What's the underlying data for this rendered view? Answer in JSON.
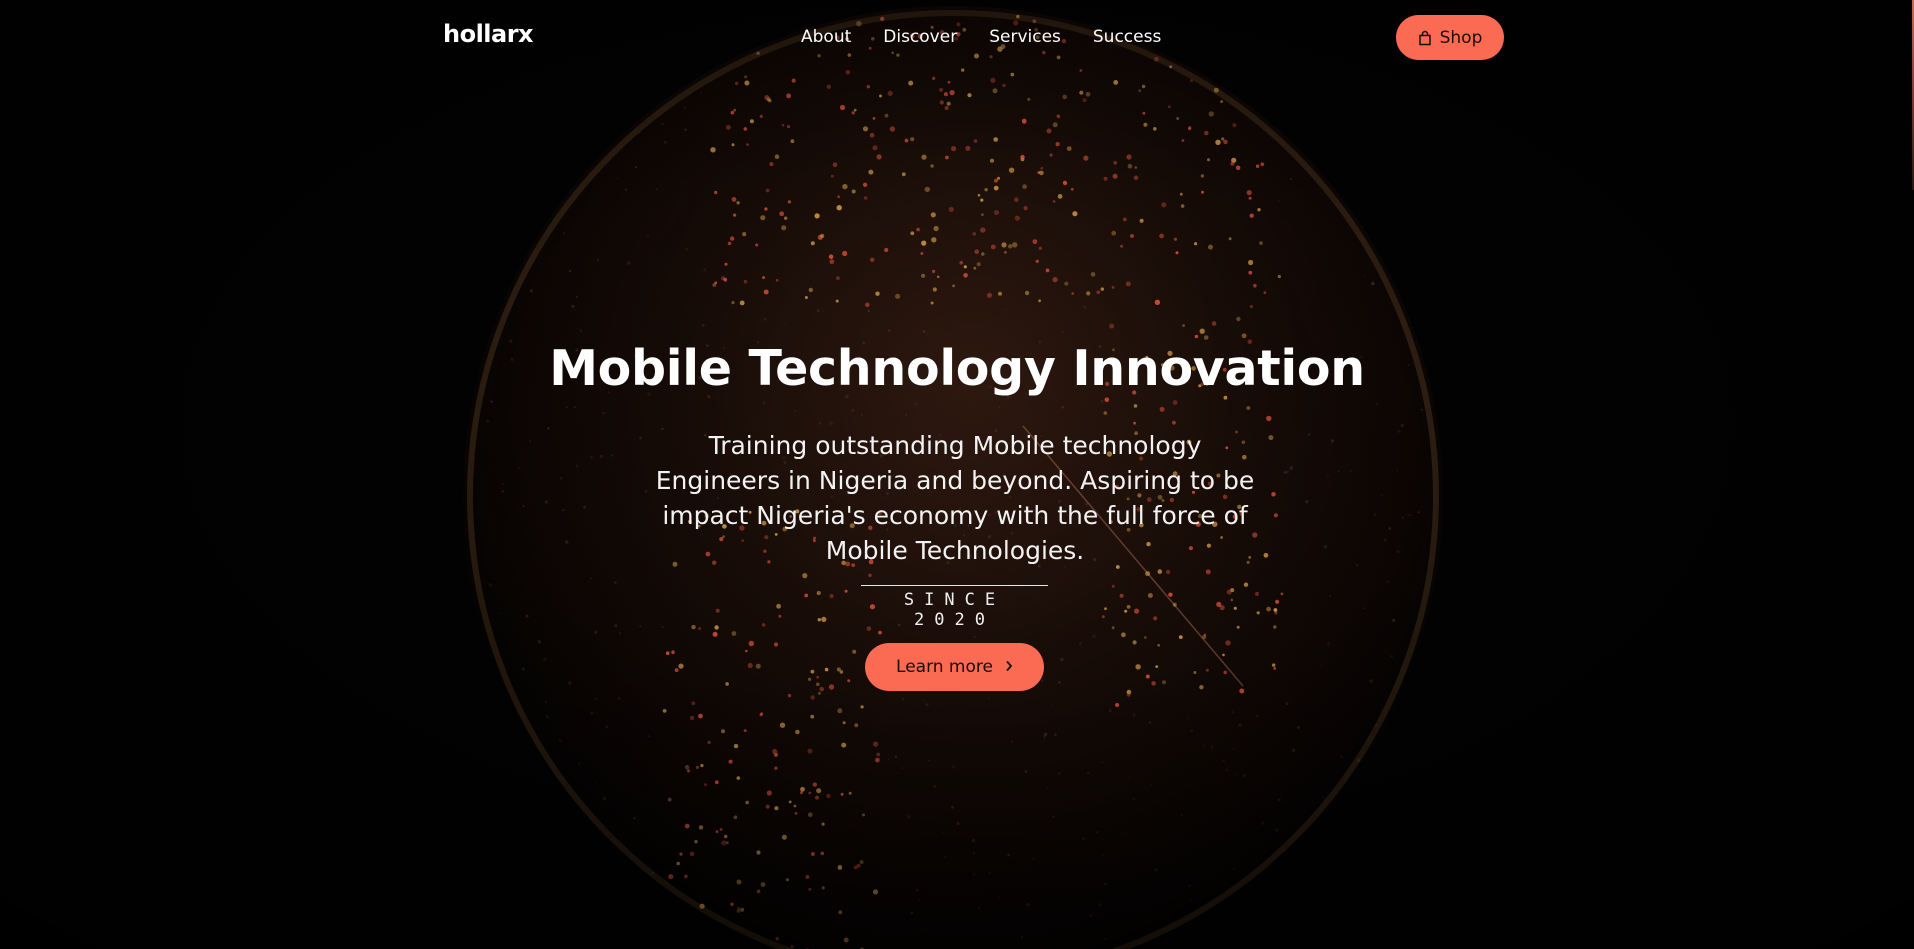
{
  "brand": {
    "logo": "hollarx"
  },
  "nav": {
    "items": [
      {
        "label": "About"
      },
      {
        "label": "Discover"
      },
      {
        "label": "Services"
      },
      {
        "label": "Success"
      }
    ]
  },
  "header": {
    "shop_label": "Shop",
    "shop_icon": "shopping-bag-icon"
  },
  "hero": {
    "title": "Mobile Technology Innovation",
    "subtitle": "Training outstanding Mobile technology Engineers in Nigeria and beyond. Aspiring to be impact Nigeria's economy with the full force of Mobile Technologies.",
    "since": "SINCE 2020",
    "cta_label": "Learn more",
    "cta_icon": "chevron-right-icon"
  },
  "colors": {
    "accent": "#fb6a53",
    "background": "#000000",
    "text": "#ffffff"
  }
}
